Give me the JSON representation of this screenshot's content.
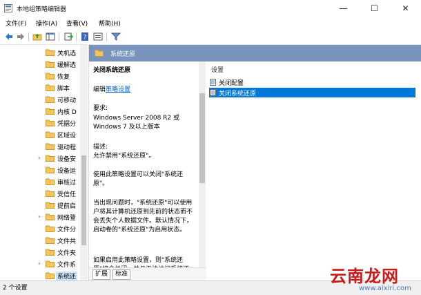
{
  "window": {
    "title": "本地组策略编辑器",
    "minimize": "—",
    "maximize": "☐",
    "close": "✕"
  },
  "menu": [
    {
      "label": "文件(F)"
    },
    {
      "label": "操作(A)"
    },
    {
      "label": "查看(V)"
    },
    {
      "label": "帮助(H)"
    }
  ],
  "toolbar": {
    "icons": [
      "back-arrow-icon",
      "forward-arrow-icon",
      "folder-up-icon",
      "show-hide-tree-icon",
      "export-list-icon",
      "help-icon",
      "properties-icon",
      "filter-icon"
    ]
  },
  "tree": {
    "items": [
      {
        "label": "关机选",
        "expandable": false
      },
      {
        "label": "缓解选",
        "expandable": false
      },
      {
        "label": "恢复",
        "expandable": false
      },
      {
        "label": "脚本",
        "expandable": false
      },
      {
        "label": "可移动",
        "expandable": false
      },
      {
        "label": "内核 D",
        "expandable": false
      },
      {
        "label": "凭据分",
        "expandable": false
      },
      {
        "label": "区域设",
        "expandable": false
      },
      {
        "label": "驱动程",
        "expandable": false
      },
      {
        "label": "设备安",
        "expandable": true
      },
      {
        "label": "设备运",
        "expandable": false
      },
      {
        "label": "审核过",
        "expandable": false
      },
      {
        "label": "受信任",
        "expandable": false
      },
      {
        "label": "提前启",
        "expandable": false
      },
      {
        "label": "网络登",
        "expandable": true
      },
      {
        "label": "文件分",
        "expandable": false
      },
      {
        "label": "文件共",
        "expandable": false
      },
      {
        "label": "文件夹",
        "expandable": false
      },
      {
        "label": "文件系",
        "expandable": true
      },
      {
        "label": "系统还",
        "expandable": false,
        "selected": true
      }
    ]
  },
  "header": {
    "title": "系统还原"
  },
  "description": {
    "title": "关闭系统还原",
    "edit_prefix": "编辑",
    "edit_link": "策略设置",
    "requirements_label": "要求:",
    "requirements_text": "Windows Server 2008 R2 或 Windows 7 及以上版本",
    "desc_label": "描述:",
    "desc_text": "允许禁用\"系统还原\"。",
    "para1": "使用此策略设置可以关闭\"系统还原\"。",
    "para2": "当出现问题时，\"系统还原\"可以使用户将其计算机还原到先前的状态而不会丢失个人数据文件。默认情况下，启动卷的\"系统还原\"为启用状态。",
    "para3": "如果启用此策略设置，则\"系统还原\"将会关闭，并且无法访问系统还"
  },
  "list": {
    "header": "设置",
    "rows": [
      {
        "label": "关闭配置",
        "selected": false
      },
      {
        "label": "关闭系统还原",
        "selected": true
      }
    ]
  },
  "tabs": [
    {
      "label": "扩展"
    },
    {
      "label": "标准"
    }
  ],
  "status": {
    "text": "2 个设置"
  },
  "watermark": {
    "brand": "云南龙网",
    "url": "www.aixiri.com"
  },
  "colors": {
    "header_bg": "#7894bd",
    "selection": "#0078d7",
    "link": "#0066cc",
    "folder": "#f3c460"
  }
}
